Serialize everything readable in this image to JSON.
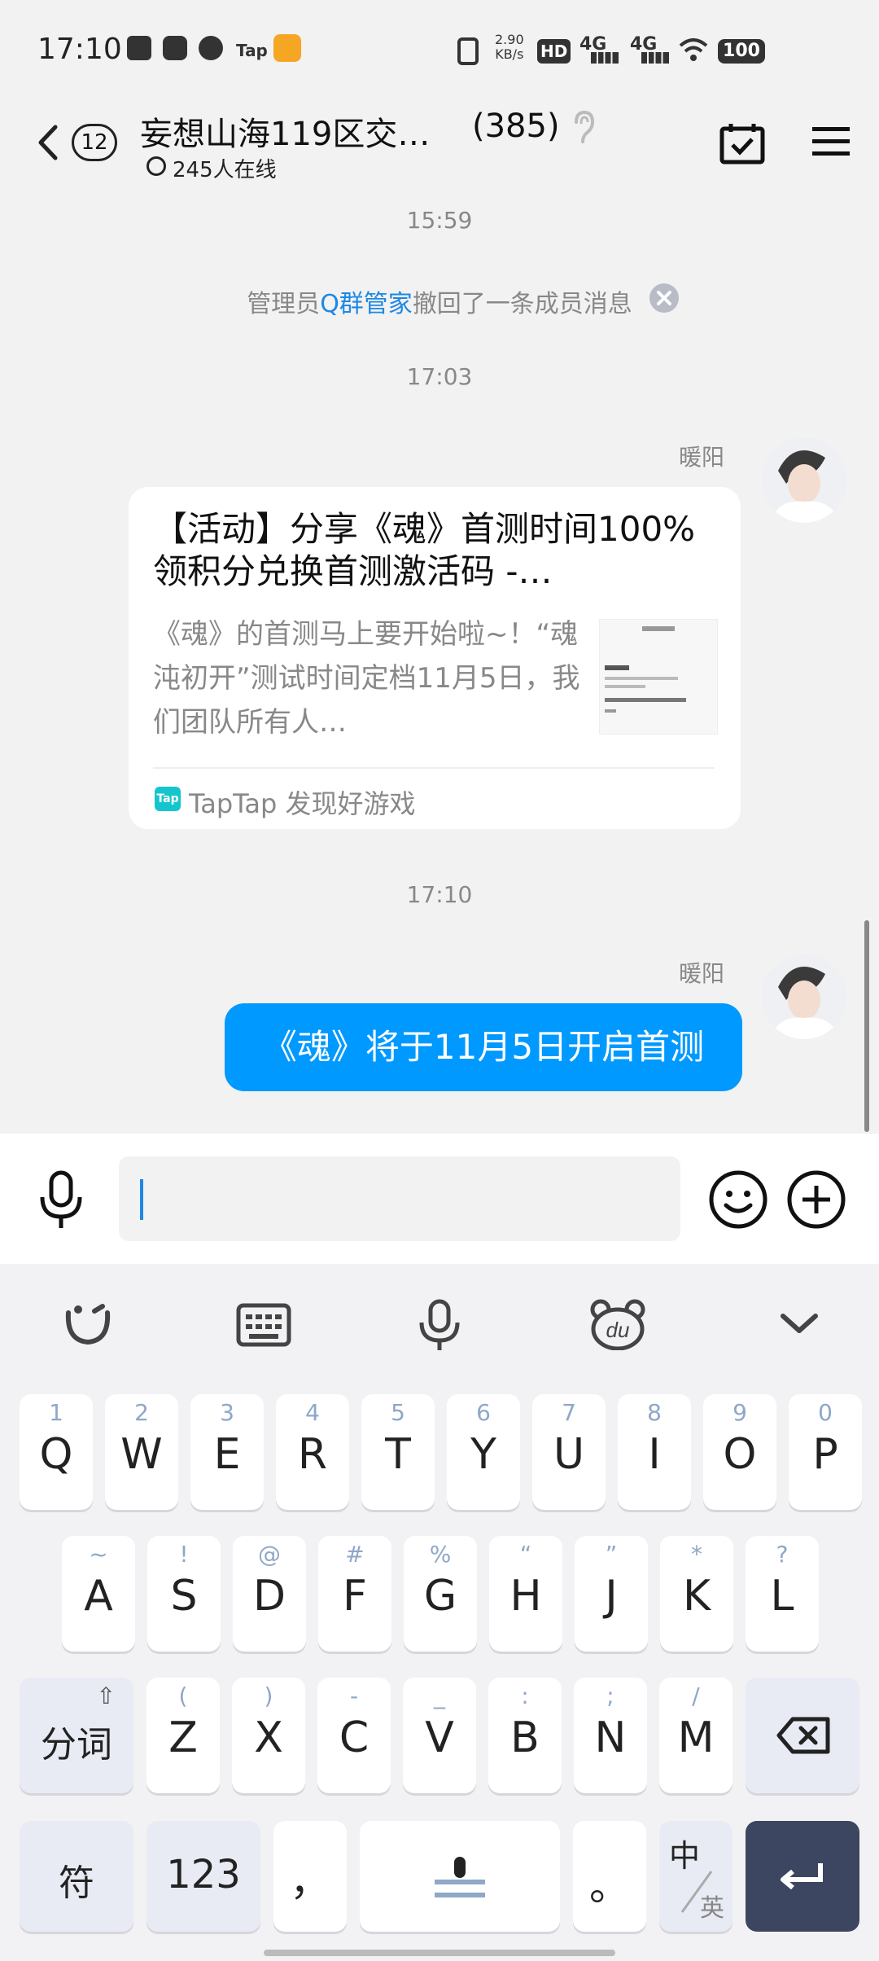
{
  "status_bar": {
    "time": "17:10",
    "net_speed": "2.90",
    "net_unit": "KB/s",
    "hd": "HD",
    "net1": "4G",
    "net2": "4G",
    "battery": "100",
    "tap_label": "Tap"
  },
  "header": {
    "badge": "12",
    "title": "妄想山海119区交…",
    "member_count": "(385)",
    "online": "245人在线"
  },
  "messages": {
    "time1": "15:59",
    "system_prefix": "管理员",
    "system_highlight": "Q群管家",
    "system_suffix": "撤回了一条成员消息",
    "time2": "17:03",
    "sender1": "暖阳",
    "card_title": "【活动】分享《魂》首测时间100%领积分兑换首测激活码 -…",
    "card_desc": "《魂》的首测马上要开始啦~！“魂沌初开”测试时间定档11月5日，我们团队所有人…",
    "card_source_icon": "Tap",
    "card_source": "TapTap 发现好游戏",
    "time3": "17:10",
    "sender2": "暖阳",
    "bubble_text": "《魂》将于11月5日开启首测"
  },
  "keyboard": {
    "row1": [
      {
        "sub": "1",
        "main": "Q"
      },
      {
        "sub": "2",
        "main": "W"
      },
      {
        "sub": "3",
        "main": "E"
      },
      {
        "sub": "4",
        "main": "R"
      },
      {
        "sub": "5",
        "main": "T"
      },
      {
        "sub": "6",
        "main": "Y"
      },
      {
        "sub": "7",
        "main": "U"
      },
      {
        "sub": "8",
        "main": "I"
      },
      {
        "sub": "9",
        "main": "O"
      },
      {
        "sub": "0",
        "main": "P"
      }
    ],
    "row2": [
      {
        "sub": "~",
        "main": "A"
      },
      {
        "sub": "!",
        "main": "S"
      },
      {
        "sub": "@",
        "main": "D"
      },
      {
        "sub": "#",
        "main": "F"
      },
      {
        "sub": "%",
        "main": "G"
      },
      {
        "sub": "“",
        "main": "H"
      },
      {
        "sub": "”",
        "main": "J"
      },
      {
        "sub": "*",
        "main": "K"
      },
      {
        "sub": "?",
        "main": "L"
      }
    ],
    "row3": [
      {
        "sub": "(",
        "main": "Z"
      },
      {
        "sub": ")",
        "main": "X"
      },
      {
        "sub": "-",
        "main": "C"
      },
      {
        "sub": "_",
        "main": "V"
      },
      {
        "sub": ":",
        "main": "B"
      },
      {
        "sub": ";",
        "main": "N"
      },
      {
        "sub": "/",
        "main": "M"
      }
    ],
    "segment_key": "分词",
    "symbol_key": "符",
    "num_key": "123",
    "comma_key": "，",
    "period_key": "。",
    "lang_key_main": "中",
    "lang_key_sub": "英"
  }
}
